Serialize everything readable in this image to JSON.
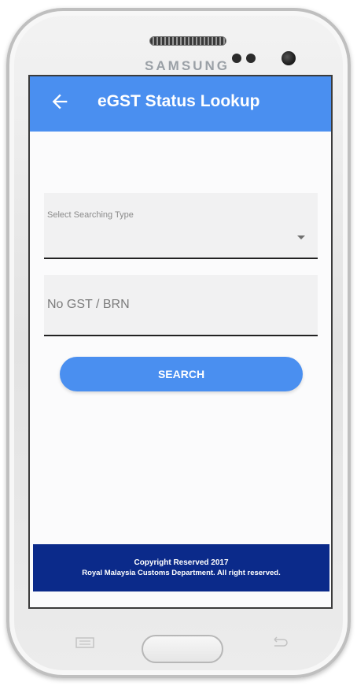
{
  "device": {
    "brand": "SAMSUNG"
  },
  "appbar": {
    "title": "eGST Status Lookup",
    "back_icon": "arrow-left-icon",
    "color": "#4a8ff0"
  },
  "form": {
    "select": {
      "label": "Select Searching Type",
      "value": "",
      "icon": "dropdown-triangle-icon"
    },
    "gst_input": {
      "placeholder": "No GST / BRN",
      "value": ""
    },
    "search_button": {
      "label": "SEARCH"
    }
  },
  "footer": {
    "line1": "Copyright Reserved 2017",
    "line2": "Royal Malaysia Customs Department. All right reserved.",
    "color": "#0b2a8a"
  },
  "hardware": {
    "menu_icon": "menu-key-icon",
    "home_icon": "home-key-icon",
    "back_icon": "back-key-icon"
  }
}
